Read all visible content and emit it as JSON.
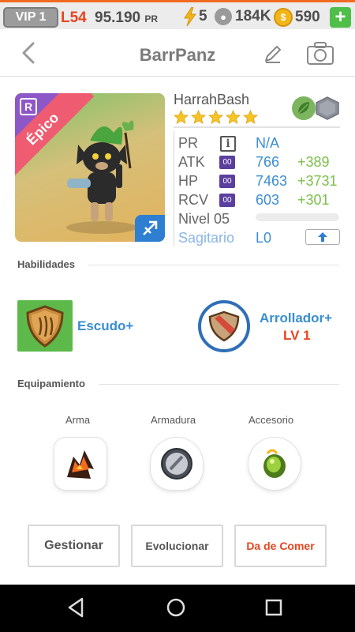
{
  "status_bar": {
    "vip": "VIP 1",
    "level": "L54",
    "pr_value": "95.190",
    "pr_unit": "PR",
    "energy": "5",
    "food": "184K",
    "coins": "590",
    "plus": "+"
  },
  "header": {
    "title": "BarrPanz"
  },
  "monster": {
    "name": "HarrahBash",
    "rarity_badge": "R",
    "rarity": "Épico",
    "stars": 5,
    "elements": [
      "nature",
      "metal"
    ],
    "stats": {
      "pr_label": "PR",
      "pr_value": "N/A",
      "atk_label": "ATK",
      "atk_value": "766",
      "atk_bonus": "+389",
      "hp_label": "HP",
      "hp_value": "7463",
      "hp_bonus": "+3731",
      "rcv_label": "RCV",
      "rcv_value": "603",
      "rcv_bonus": "+301",
      "level_label": "Nivel 05",
      "level_progress": 0,
      "sign_label": "Sagitario",
      "sign_level": "L0",
      "rune_badge": "00",
      "info_glyph": "i"
    }
  },
  "skills": {
    "title": "Habilidades",
    "items": [
      {
        "name": "Escudo+",
        "icon": "shield-icon"
      },
      {
        "name": "Arrollador+",
        "level": "LV 1",
        "icon": "trample-icon"
      }
    ]
  },
  "equipment": {
    "title": "Equipamiento",
    "slots": [
      {
        "label": "Arma"
      },
      {
        "label": "Armadura"
      },
      {
        "label": "Accesorio"
      }
    ]
  },
  "actions": {
    "manage": "Gestionar",
    "evolve": "Evolucionar",
    "feed": "Da de Comer"
  },
  "colors": {
    "accent_blue": "#3a8ed2",
    "bonus_green": "#7bbf4a",
    "orange": "#e8441e",
    "rarity_pink": "#ef5b70"
  }
}
